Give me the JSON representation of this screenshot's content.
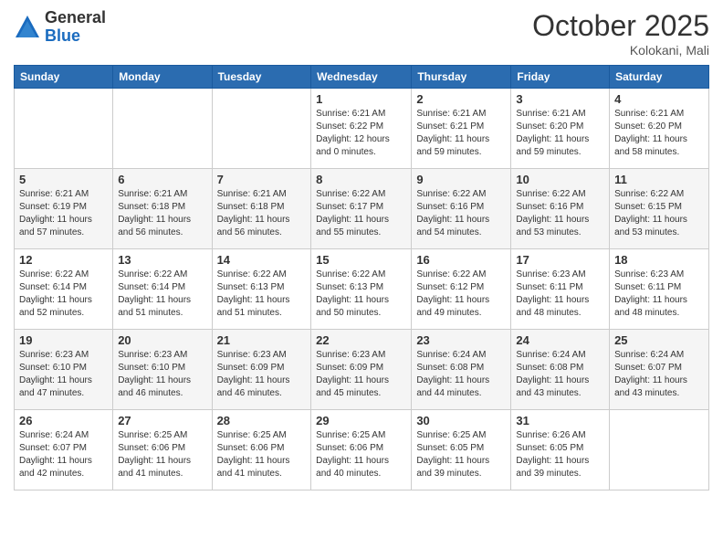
{
  "logo": {
    "general": "General",
    "blue": "Blue"
  },
  "header": {
    "month": "October 2025",
    "location": "Kolokani, Mali"
  },
  "weekdays": [
    "Sunday",
    "Monday",
    "Tuesday",
    "Wednesday",
    "Thursday",
    "Friday",
    "Saturday"
  ],
  "weeks": [
    [
      {
        "day": "",
        "info": ""
      },
      {
        "day": "",
        "info": ""
      },
      {
        "day": "",
        "info": ""
      },
      {
        "day": "1",
        "info": "Sunrise: 6:21 AM\nSunset: 6:22 PM\nDaylight: 12 hours\nand 0 minutes."
      },
      {
        "day": "2",
        "info": "Sunrise: 6:21 AM\nSunset: 6:21 PM\nDaylight: 11 hours\nand 59 minutes."
      },
      {
        "day": "3",
        "info": "Sunrise: 6:21 AM\nSunset: 6:20 PM\nDaylight: 11 hours\nand 59 minutes."
      },
      {
        "day": "4",
        "info": "Sunrise: 6:21 AM\nSunset: 6:20 PM\nDaylight: 11 hours\nand 58 minutes."
      }
    ],
    [
      {
        "day": "5",
        "info": "Sunrise: 6:21 AM\nSunset: 6:19 PM\nDaylight: 11 hours\nand 57 minutes."
      },
      {
        "day": "6",
        "info": "Sunrise: 6:21 AM\nSunset: 6:18 PM\nDaylight: 11 hours\nand 56 minutes."
      },
      {
        "day": "7",
        "info": "Sunrise: 6:21 AM\nSunset: 6:18 PM\nDaylight: 11 hours\nand 56 minutes."
      },
      {
        "day": "8",
        "info": "Sunrise: 6:22 AM\nSunset: 6:17 PM\nDaylight: 11 hours\nand 55 minutes."
      },
      {
        "day": "9",
        "info": "Sunrise: 6:22 AM\nSunset: 6:16 PM\nDaylight: 11 hours\nand 54 minutes."
      },
      {
        "day": "10",
        "info": "Sunrise: 6:22 AM\nSunset: 6:16 PM\nDaylight: 11 hours\nand 53 minutes."
      },
      {
        "day": "11",
        "info": "Sunrise: 6:22 AM\nSunset: 6:15 PM\nDaylight: 11 hours\nand 53 minutes."
      }
    ],
    [
      {
        "day": "12",
        "info": "Sunrise: 6:22 AM\nSunset: 6:14 PM\nDaylight: 11 hours\nand 52 minutes."
      },
      {
        "day": "13",
        "info": "Sunrise: 6:22 AM\nSunset: 6:14 PM\nDaylight: 11 hours\nand 51 minutes."
      },
      {
        "day": "14",
        "info": "Sunrise: 6:22 AM\nSunset: 6:13 PM\nDaylight: 11 hours\nand 51 minutes."
      },
      {
        "day": "15",
        "info": "Sunrise: 6:22 AM\nSunset: 6:13 PM\nDaylight: 11 hours\nand 50 minutes."
      },
      {
        "day": "16",
        "info": "Sunrise: 6:22 AM\nSunset: 6:12 PM\nDaylight: 11 hours\nand 49 minutes."
      },
      {
        "day": "17",
        "info": "Sunrise: 6:23 AM\nSunset: 6:11 PM\nDaylight: 11 hours\nand 48 minutes."
      },
      {
        "day": "18",
        "info": "Sunrise: 6:23 AM\nSunset: 6:11 PM\nDaylight: 11 hours\nand 48 minutes."
      }
    ],
    [
      {
        "day": "19",
        "info": "Sunrise: 6:23 AM\nSunset: 6:10 PM\nDaylight: 11 hours\nand 47 minutes."
      },
      {
        "day": "20",
        "info": "Sunrise: 6:23 AM\nSunset: 6:10 PM\nDaylight: 11 hours\nand 46 minutes."
      },
      {
        "day": "21",
        "info": "Sunrise: 6:23 AM\nSunset: 6:09 PM\nDaylight: 11 hours\nand 46 minutes."
      },
      {
        "day": "22",
        "info": "Sunrise: 6:23 AM\nSunset: 6:09 PM\nDaylight: 11 hours\nand 45 minutes."
      },
      {
        "day": "23",
        "info": "Sunrise: 6:24 AM\nSunset: 6:08 PM\nDaylight: 11 hours\nand 44 minutes."
      },
      {
        "day": "24",
        "info": "Sunrise: 6:24 AM\nSunset: 6:08 PM\nDaylight: 11 hours\nand 43 minutes."
      },
      {
        "day": "25",
        "info": "Sunrise: 6:24 AM\nSunset: 6:07 PM\nDaylight: 11 hours\nand 43 minutes."
      }
    ],
    [
      {
        "day": "26",
        "info": "Sunrise: 6:24 AM\nSunset: 6:07 PM\nDaylight: 11 hours\nand 42 minutes."
      },
      {
        "day": "27",
        "info": "Sunrise: 6:25 AM\nSunset: 6:06 PM\nDaylight: 11 hours\nand 41 minutes."
      },
      {
        "day": "28",
        "info": "Sunrise: 6:25 AM\nSunset: 6:06 PM\nDaylight: 11 hours\nand 41 minutes."
      },
      {
        "day": "29",
        "info": "Sunrise: 6:25 AM\nSunset: 6:06 PM\nDaylight: 11 hours\nand 40 minutes."
      },
      {
        "day": "30",
        "info": "Sunrise: 6:25 AM\nSunset: 6:05 PM\nDaylight: 11 hours\nand 39 minutes."
      },
      {
        "day": "31",
        "info": "Sunrise: 6:26 AM\nSunset: 6:05 PM\nDaylight: 11 hours\nand 39 minutes."
      },
      {
        "day": "",
        "info": ""
      }
    ]
  ]
}
